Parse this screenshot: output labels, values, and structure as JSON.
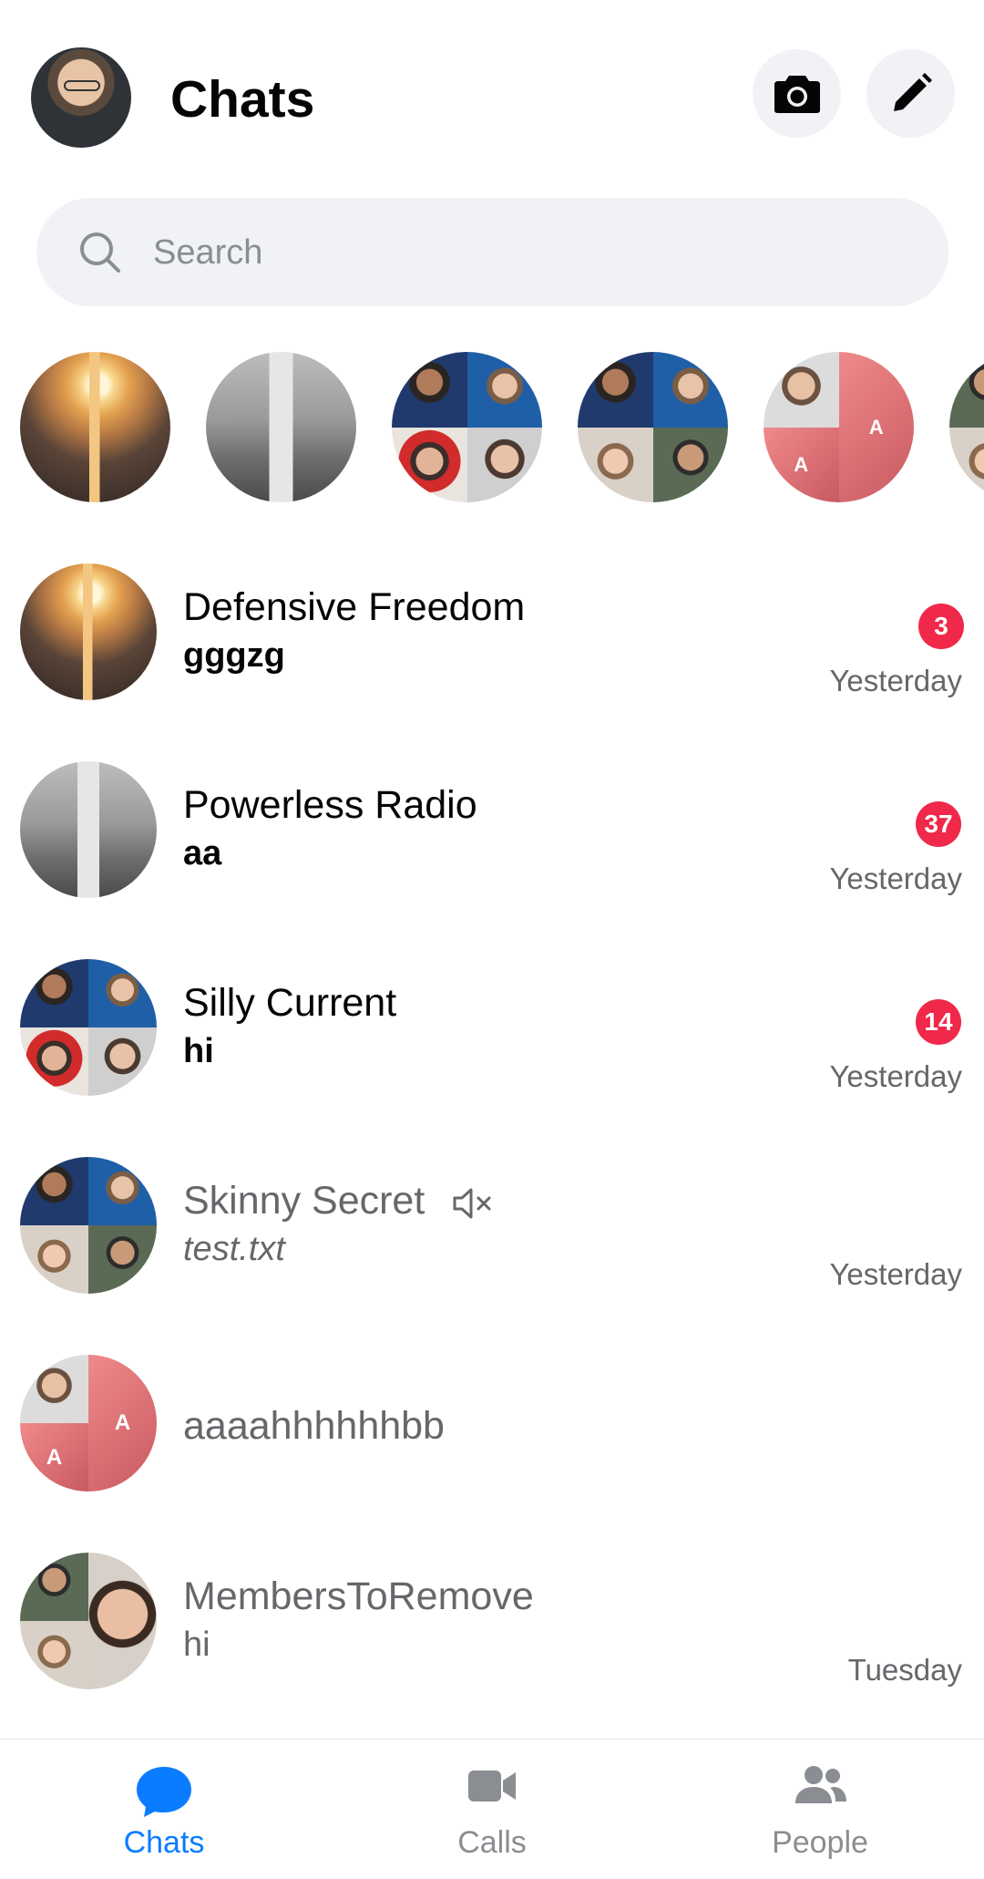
{
  "header": {
    "title": "Chats",
    "camera_icon": "camera-icon",
    "compose_icon": "pencil-icon"
  },
  "search": {
    "placeholder": "Search",
    "value": ""
  },
  "stories": [
    {
      "name": "Defensive Freedom",
      "avatar": "sunset-road"
    },
    {
      "name": "Powerless Radio",
      "avatar": "lighthouse"
    },
    {
      "name": "Silly Current",
      "avatar": "four-faces"
    },
    {
      "name": "Skinny Secret",
      "avatar": "four-faces"
    },
    {
      "name": "aaaahhhhhhbb",
      "avatar": "face-and-letters",
      "letters": [
        "A",
        "A"
      ]
    },
    {
      "name": "MembersToRemove",
      "avatar": "partial"
    }
  ],
  "chats": [
    {
      "name": "Defensive Freedom",
      "preview": "gggzg",
      "time": "Yesterday",
      "unread": "3",
      "muted": false
    },
    {
      "name": "Powerless Radio",
      "preview": "aa",
      "time": "Yesterday",
      "unread": "37",
      "muted": false
    },
    {
      "name": "Silly Current",
      "preview": "hi",
      "time": "Yesterday",
      "unread": "14",
      "muted": false
    },
    {
      "name": "Skinny Secret",
      "preview": "test.txt",
      "time": "Yesterday",
      "unread": null,
      "muted": true
    },
    {
      "name": "aaaahhhhhhbb",
      "preview": "",
      "time": "",
      "unread": null,
      "muted": false,
      "letters": [
        "A",
        "A"
      ]
    },
    {
      "name": "MembersToRemove",
      "preview": "hi",
      "time": "Tuesday",
      "unread": null,
      "muted": false
    }
  ],
  "nav": {
    "chats": "Chats",
    "calls": "Calls",
    "people": "People"
  },
  "colors": {
    "accent": "#0a7cff",
    "badge": "#f02849",
    "secondary_text": "#65676b",
    "search_bg": "#f0f2f5"
  }
}
